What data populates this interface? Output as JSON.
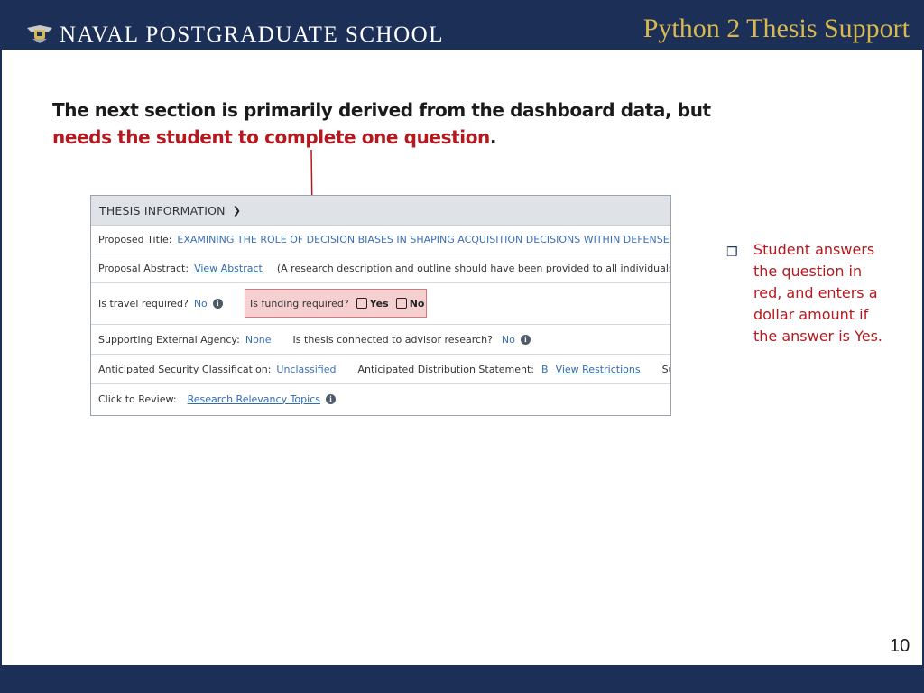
{
  "header": {
    "school_name": "NAVAL POSTGRADUATE SCHOOL",
    "deck_title": "Python 2 Thesis Support",
    "logo_icon": "nps-crest-icon"
  },
  "intro": {
    "line_black": "The next section is primarily derived from the dashboard data, but",
    "line_red": "needs the student to complete one question",
    "period": "."
  },
  "panel": {
    "heading": "THESIS INFORMATION",
    "proposed_title_label": "Proposed Title:",
    "proposed_title_value": "EXAMINING THE ROLE OF DECISION BIASES IN SHAPING ACQUISITION DECISIONS WITHIN DEFENSE AC",
    "abstract_label": "Proposal Abstract:",
    "abstract_link": "View Abstract",
    "abstract_note": "(A research description and outline should have been provided to all individuals ap",
    "travel_label": "Is travel required?",
    "travel_value": "No",
    "funding_label": "Is funding required?",
    "funding_yes": "Yes",
    "funding_no": "No",
    "agency_label": "Supporting External Agency:",
    "agency_value": "None",
    "advisor_label": "Is thesis connected to advisor research?",
    "advisor_value": "No",
    "security_label": "Anticipated Security Classification:",
    "security_value": "Unclassified",
    "distribution_label": "Anticipated Distribution Statement:",
    "distribution_value": "B",
    "restrictions_link": "View Restrictions",
    "truncated_text": "Sup",
    "review_label": "Click to Review:",
    "review_link": "Research Relevancy Topics"
  },
  "bullet": {
    "icon": "checkbox-bullet-icon",
    "text": "Student answers the question in red, and enters a dollar amount if the answer is Yes."
  },
  "page_number": "10",
  "colors": {
    "navy": "#1b2f57",
    "gold": "#d8b84f",
    "red": "#b4191f",
    "highlight": "#f6d0d1"
  }
}
